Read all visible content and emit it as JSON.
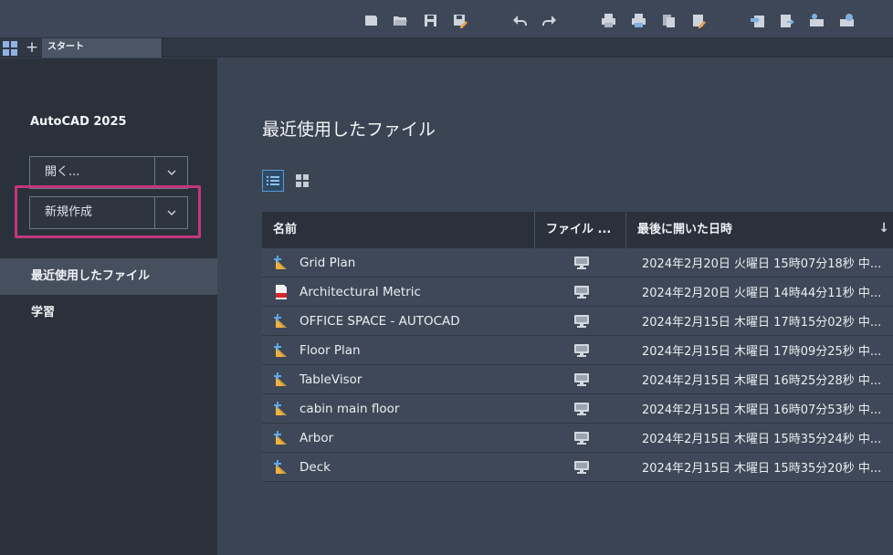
{
  "tabs": {
    "start": "スタート"
  },
  "sidebar": {
    "app_title": "AutoCAD 2025",
    "open_label": "開く...",
    "new_label": "新規作成",
    "nav": [
      {
        "label": "最近使用したファイル"
      },
      {
        "label": "学習"
      }
    ]
  },
  "main": {
    "title": "最近使用したファイル",
    "columns": {
      "name": "名前",
      "location": "ファイル ...",
      "last_opened": "最後に開いた日時"
    },
    "files": [
      {
        "name": "Grid Plan",
        "type": "dwg",
        "date": "2024年2月20日 火曜日 15時07分18秒 中..."
      },
      {
        "name": "Architectural Metric",
        "type": "dwt",
        "date": "2024年2月20日 火曜日 14時44分11秒 中..."
      },
      {
        "name": "OFFICE SPACE - AUTOCAD",
        "type": "dwg",
        "date": "2024年2月15日 木曜日 17時15分02秒 中..."
      },
      {
        "name": "Floor Plan",
        "type": "dwg",
        "date": "2024年2月15日 木曜日 17時09分25秒 中..."
      },
      {
        "name": "TableVisor",
        "type": "dwg",
        "date": "2024年2月15日 木曜日 16時25分28秒 中..."
      },
      {
        "name": "cabin main floor",
        "type": "dwg",
        "date": "2024年2月15日 木曜日 16時07分53秒 中..."
      },
      {
        "name": "Arbor",
        "type": "dwg",
        "date": "2024年2月15日 木曜日 15時35分24秒 中..."
      },
      {
        "name": "Deck",
        "type": "dwg",
        "date": "2024年2月15日 木曜日 15時35分20秒 中..."
      }
    ]
  },
  "colors": {
    "highlight": "#c2377e",
    "accent": "#5a9ad6"
  }
}
